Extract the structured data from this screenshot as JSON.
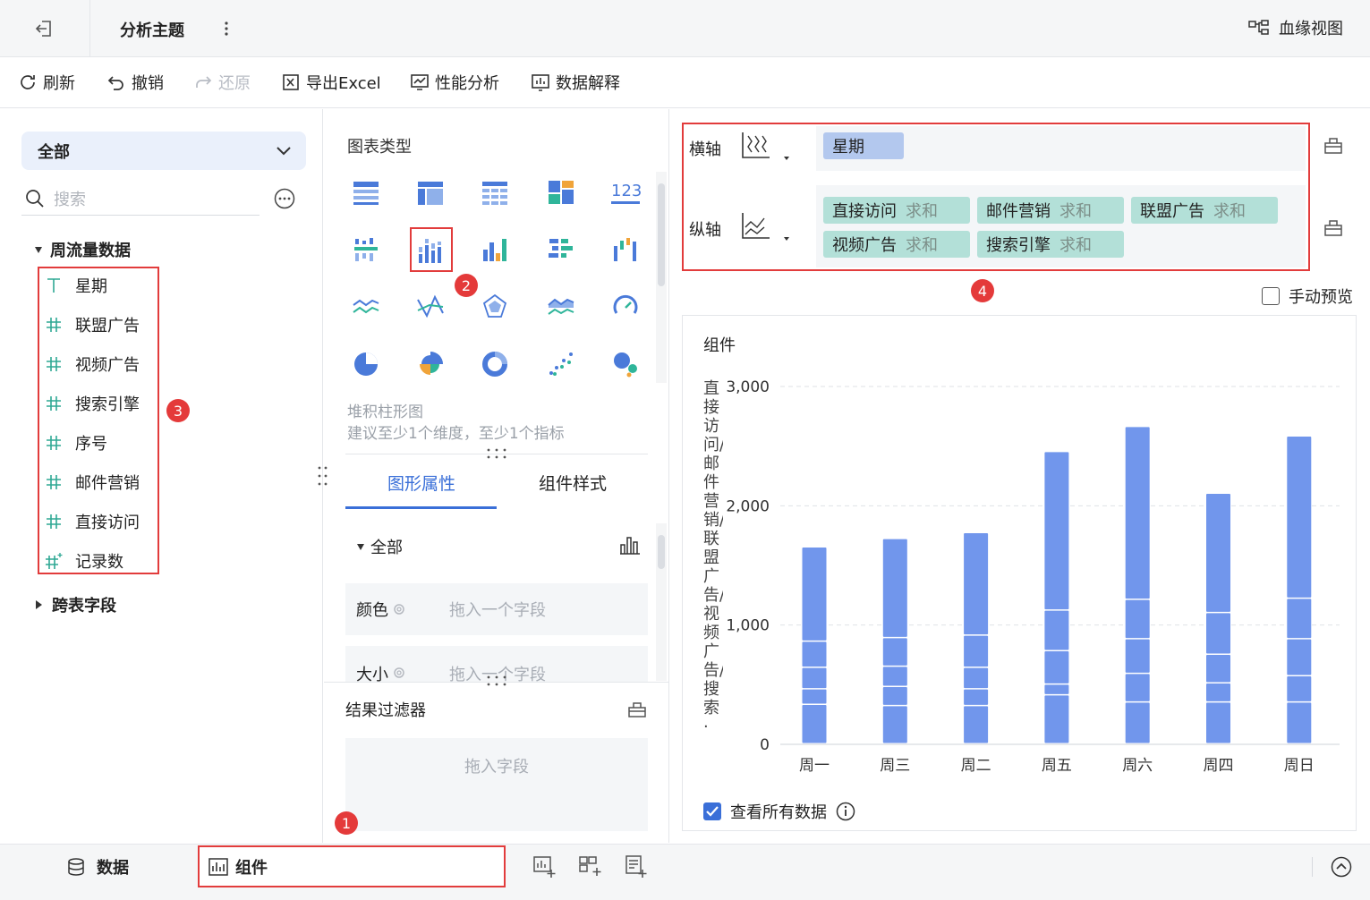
{
  "header": {
    "title": "分析主题",
    "lineage_label": "血缘视图"
  },
  "toolbar": {
    "refresh": "刷新",
    "undo": "撤销",
    "redo": "还原",
    "export": "导出Excel",
    "perf": "性能分析",
    "explain": "数据解释"
  },
  "left": {
    "scope": "全部",
    "search_placeholder": "搜索",
    "group1": "周流量数据",
    "fields": [
      {
        "type": "text",
        "name": "星期"
      },
      {
        "type": "number",
        "name": "联盟广告"
      },
      {
        "type": "number",
        "name": "视频广告"
      },
      {
        "type": "number",
        "name": "搜索引擎"
      },
      {
        "type": "number",
        "name": "序号"
      },
      {
        "type": "number",
        "name": "邮件营销"
      },
      {
        "type": "number",
        "name": "直接访问"
      },
      {
        "type": "computed",
        "name": "记录数"
      }
    ],
    "group2": "跨表字段"
  },
  "badges": [
    "1",
    "2",
    "3",
    "4"
  ],
  "middle": {
    "chart_types_label": "图表类型",
    "selected_name": "堆积柱形图",
    "selected_hint": "建议至少1个维度，至少1个指标",
    "tabs": [
      "图形属性",
      "组件样式"
    ],
    "prop_all": "全部",
    "color_label": "颜色",
    "size_label": "大小",
    "drop_placeholder": "拖入一个字段",
    "filter_label": "结果过滤器",
    "filter_drop": "拖入字段",
    "kpi_text": "123"
  },
  "axes": {
    "x_label": "横轴",
    "y_label": "纵轴",
    "x_fields": [
      {
        "name": "星期"
      }
    ],
    "y_fields": [
      {
        "name": "直接访问",
        "agg": "求和"
      },
      {
        "name": "邮件营销",
        "agg": "求和"
      },
      {
        "name": "联盟广告",
        "agg": "求和"
      },
      {
        "name": "视频广告",
        "agg": "求和"
      },
      {
        "name": "搜索引擎",
        "agg": "求和"
      }
    ],
    "manual_preview": "手动预览"
  },
  "chart_card": {
    "title": "组件",
    "ylabel": "直接访问/邮件营销/联盟广告/视频广告/搜索·",
    "view_all": "查看所有数据"
  },
  "chart_data": {
    "type": "bar",
    "stacked": true,
    "categories": [
      "周一",
      "周三",
      "周二",
      "周五",
      "周六",
      "周四",
      "周日"
    ],
    "series": [
      {
        "values": [
          330,
          320,
          320,
          410,
          350,
          350,
          350
        ]
      },
      {
        "values": [
          130,
          160,
          140,
          90,
          240,
          160,
          220
        ]
      },
      {
        "values": [
          180,
          170,
          180,
          280,
          290,
          240,
          310
        ]
      },
      {
        "values": [
          220,
          240,
          270,
          340,
          330,
          350,
          340
        ]
      },
      {
        "values": [
          790,
          830,
          860,
          1330,
          1450,
          1000,
          1360
        ]
      }
    ],
    "yticks": [
      "0",
      "1,000",
      "2,000",
      "3,000"
    ],
    "ylim": [
      0,
      3000
    ],
    "color": "#7196ec",
    "grid": true
  },
  "bottom": {
    "data_tab": "数据",
    "component_tab": "组件"
  }
}
